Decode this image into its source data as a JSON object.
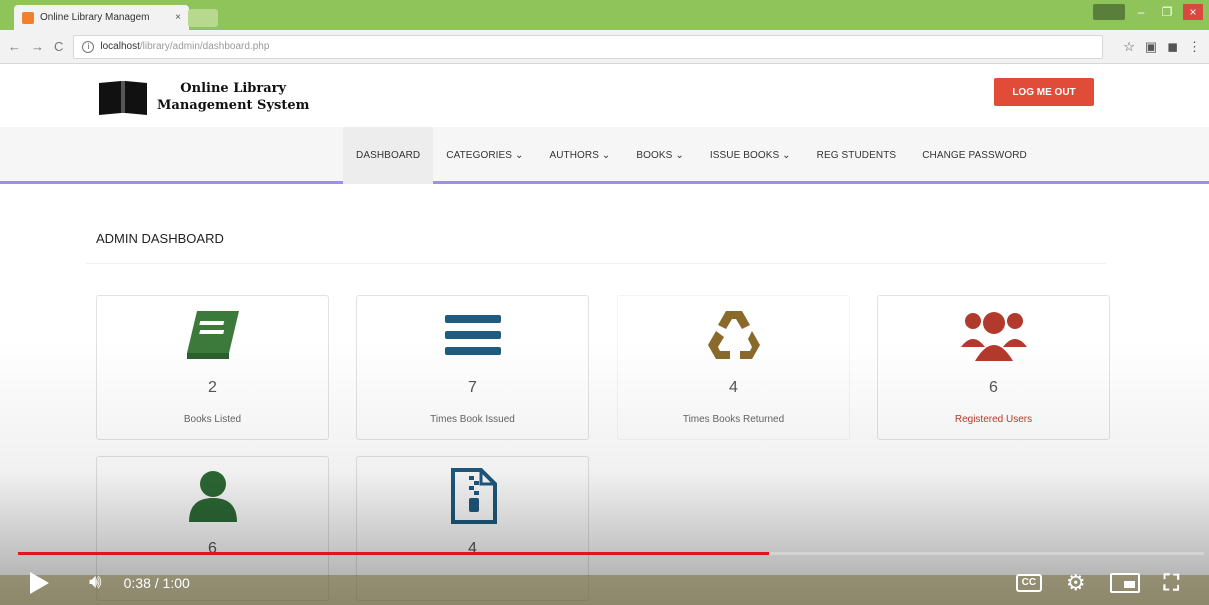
{
  "browser": {
    "tab_title": "Online Library Managem",
    "tab_close": "×",
    "url_host": "localhost",
    "url_path": "/library/admin/dashboard.php",
    "nav": {
      "back": "←",
      "forward": "→",
      "reload": "C",
      "info": "ⓘ"
    },
    "window": {
      "minimize": "–",
      "maximize": "❐",
      "close": "×"
    },
    "extensions": [
      "☆",
      "▣",
      "◼",
      "⋮"
    ]
  },
  "site": {
    "brand_line1": "Online Library",
    "brand_line2": "Management System",
    "logout_label": "LOG ME OUT"
  },
  "menu": [
    {
      "label": "DASHBOARD",
      "active": true
    },
    {
      "label": "CATEGORIES ⌄"
    },
    {
      "label": "AUTHORS ⌄"
    },
    {
      "label": "BOOKS ⌄"
    },
    {
      "label": "ISSUE BOOKS ⌄"
    },
    {
      "label": "REG STUDENTS"
    },
    {
      "label": "CHANGE PASSWORD"
    }
  ],
  "dashboard": {
    "title": "ADMIN DASHBOARD",
    "cards": [
      {
        "count": "2",
        "label": "Books Listed",
        "icon": "book-icon",
        "color": "#3b7a3b"
      },
      {
        "count": "7",
        "label": "Times Book Issued",
        "icon": "list-icon",
        "color": "#1f5a80"
      },
      {
        "count": "4",
        "label": "Times Books Returned",
        "icon": "recycle-icon",
        "color": "#8a6a2a"
      },
      {
        "count": "6",
        "label": "Registered Users",
        "icon": "users-icon",
        "color": "#b23a2c"
      },
      {
        "count": "6",
        "label": "",
        "icon": "user-icon",
        "color": "#2e6b37"
      },
      {
        "count": "4",
        "label": "",
        "icon": "zip-file-icon",
        "color": "#1f5a80"
      }
    ]
  },
  "player": {
    "time": "0:38 / 1:00",
    "progress_fraction": 0.633,
    "cc_label": "CC"
  }
}
